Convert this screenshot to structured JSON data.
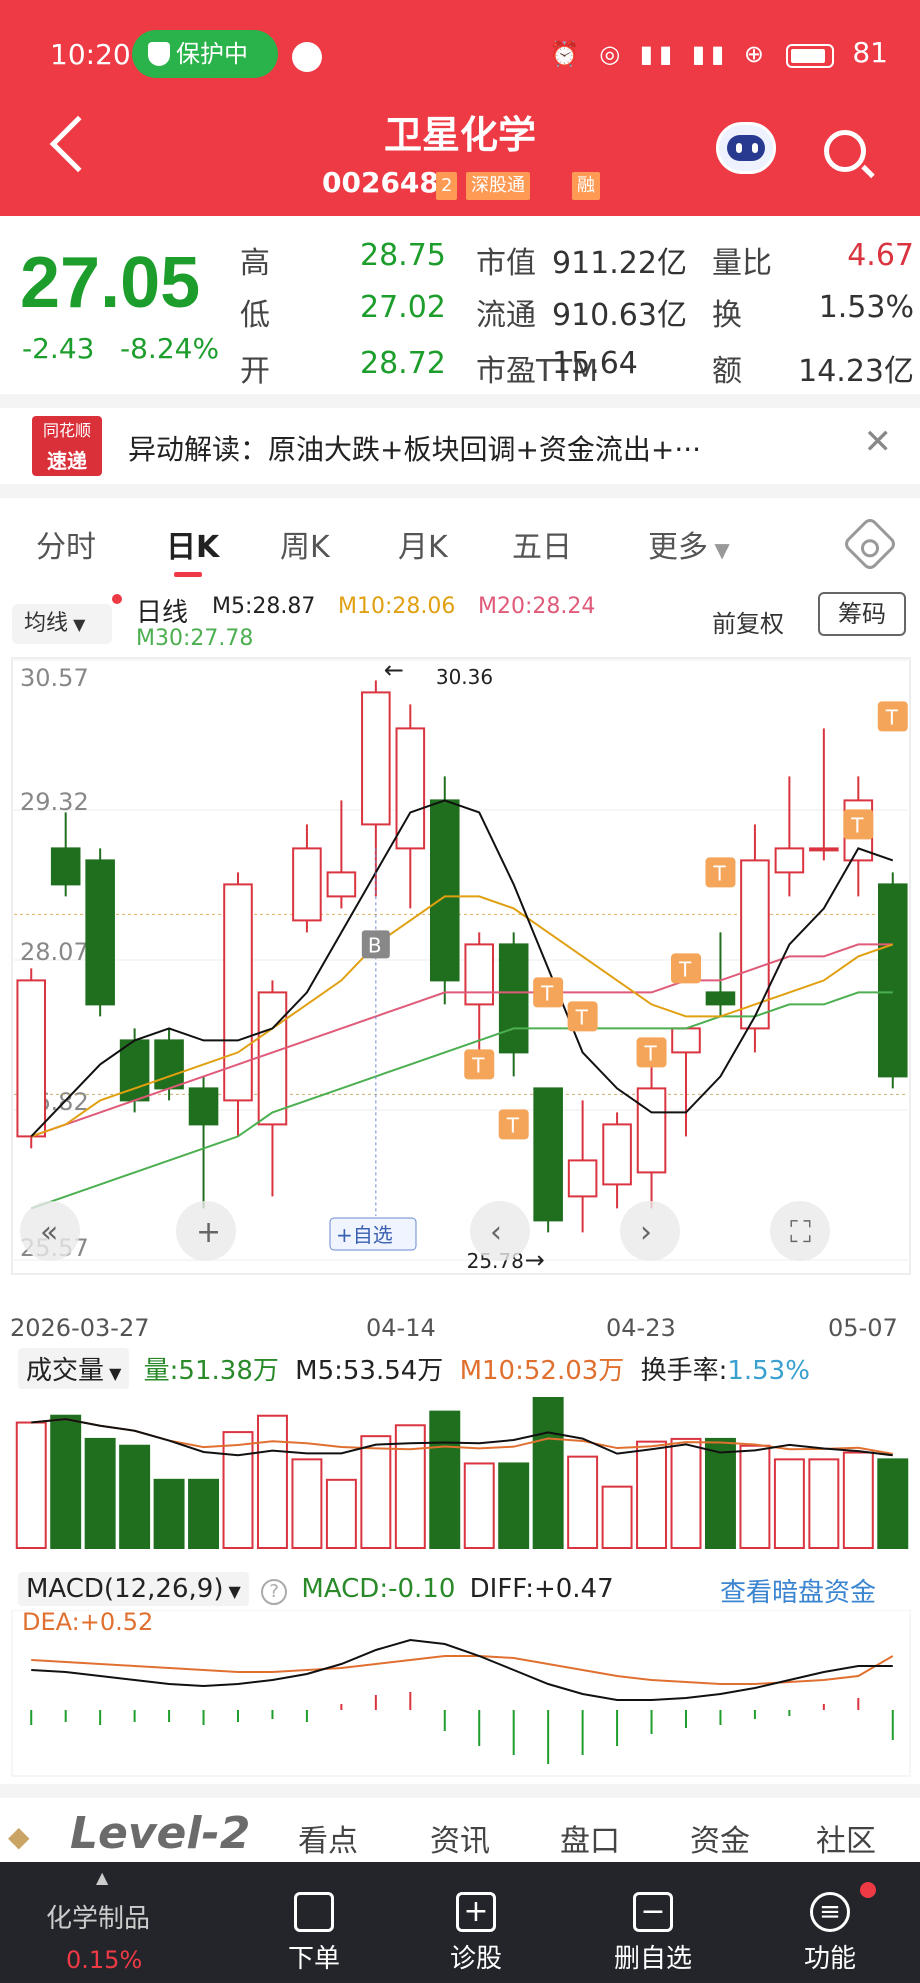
{
  "status": {
    "time": "10:20",
    "protect": "保护中",
    "battery": "81"
  },
  "header": {
    "title": "卫星化学",
    "code": "002648",
    "tag_2": "2",
    "tag_sgt": "深股通",
    "tag_rong": "融"
  },
  "quote": {
    "price": "27.05",
    "change": "-2.43",
    "change_pct": "-8.24%",
    "stats": [
      {
        "label": "高",
        "value": "28.75"
      },
      {
        "label": "市值",
        "value": "911.22亿"
      },
      {
        "label": "量比",
        "value": "4.67"
      },
      {
        "label": "低",
        "value": "27.02"
      },
      {
        "label": "流通",
        "value": "910.63亿"
      },
      {
        "label": "换",
        "value": "1.53%"
      },
      {
        "label": "开",
        "value": "28.72"
      },
      {
        "label": "市盈TTM",
        "value": "15.64"
      },
      {
        "label": "额",
        "value": "14.23亿"
      }
    ]
  },
  "news": {
    "logo_top": "同花顺",
    "logo_bottom": "速递",
    "text": "异动解读：原油大跌+板块回调+资金流出+···",
    "close": "✕"
  },
  "tabs": [
    "分时",
    "日K",
    "周K",
    "月K",
    "五日",
    "更多"
  ],
  "ma": {
    "selector": "均线",
    "period": "日线",
    "m5": "M5:28.87",
    "m10": "M10:28.06",
    "m20": "M20:28.24",
    "m30": "M30:27.78",
    "adjust": "前复权",
    "chip": "筹码"
  },
  "chart_data": {
    "type": "candlestick",
    "y_ticks": [
      "30.57",
      "29.32",
      "28.07",
      "26.82",
      "25.57"
    ],
    "x_ticks": [
      "2026-03-27",
      "04-14",
      "04-23",
      "05-07"
    ],
    "annotations": {
      "high": "30.36",
      "low": "25.78",
      "buy_marker": "B",
      "t_marker": "T"
    },
    "candles": [
      {
        "o": 26.6,
        "h": 28.0,
        "l": 26.5,
        "c": 27.9
      },
      {
        "o": 29.0,
        "h": 29.3,
        "l": 28.6,
        "c": 28.7
      },
      {
        "o": 28.9,
        "h": 29.0,
        "l": 27.6,
        "c": 27.7
      },
      {
        "o": 27.4,
        "h": 27.5,
        "l": 26.8,
        "c": 26.9
      },
      {
        "o": 27.4,
        "h": 27.5,
        "l": 26.9,
        "c": 27.0
      },
      {
        "o": 27.0,
        "h": 27.1,
        "l": 26.0,
        "c": 26.7
      },
      {
        "o": 26.9,
        "h": 28.8,
        "l": 26.6,
        "c": 28.7
      },
      {
        "o": 26.7,
        "h": 27.9,
        "l": 26.1,
        "c": 27.8
      },
      {
        "o": 28.4,
        "h": 29.2,
        "l": 28.3,
        "c": 29.0
      },
      {
        "o": 28.6,
        "h": 29.4,
        "l": 28.5,
        "c": 28.8
      },
      {
        "o": 29.2,
        "h": 30.4,
        "l": 28.6,
        "c": 30.3
      },
      {
        "o": 29.0,
        "h": 30.2,
        "l": 28.5,
        "c": 30.0
      },
      {
        "o": 29.4,
        "h": 29.6,
        "l": 27.7,
        "c": 27.9
      },
      {
        "o": 27.7,
        "h": 28.3,
        "l": 27.2,
        "c": 28.2
      },
      {
        "o": 28.2,
        "h": 28.3,
        "l": 27.1,
        "c": 27.3
      },
      {
        "o": 27.0,
        "h": 27.0,
        "l": 25.8,
        "c": 25.9
      },
      {
        "o": 26.1,
        "h": 26.9,
        "l": 25.8,
        "c": 26.4
      },
      {
        "o": 26.2,
        "h": 26.8,
        "l": 26.0,
        "c": 26.7
      },
      {
        "o": 26.3,
        "h": 27.2,
        "l": 26.0,
        "c": 27.0
      },
      {
        "o": 27.3,
        "h": 27.5,
        "l": 26.6,
        "c": 27.5
      },
      {
        "o": 27.8,
        "h": 28.3,
        "l": 27.6,
        "c": 27.7
      },
      {
        "o": 27.5,
        "h": 29.2,
        "l": 27.3,
        "c": 28.9
      },
      {
        "o": 28.8,
        "h": 29.6,
        "l": 28.6,
        "c": 29.0
      },
      {
        "o": 29.0,
        "h": 30.0,
        "l": 28.9,
        "c": 29.0
      },
      {
        "o": 28.9,
        "h": 29.6,
        "l": 28.6,
        "c": 29.4
      },
      {
        "o": 28.7,
        "h": 28.8,
        "l": 27.0,
        "c": 27.1
      }
    ],
    "ma5": [
      26.6,
      26.9,
      27.2,
      27.4,
      27.5,
      27.4,
      27.4,
      27.5,
      27.8,
      28.3,
      28.8,
      29.3,
      29.4,
      29.3,
      28.7,
      28.0,
      27.3,
      27.0,
      26.8,
      26.8,
      27.1,
      27.6,
      28.2,
      28.5,
      29.0,
      28.9
    ],
    "ma10": [
      26.6,
      26.7,
      26.9,
      27.0,
      27.1,
      27.2,
      27.3,
      27.5,
      27.7,
      27.9,
      28.2,
      28.4,
      28.6,
      28.6,
      28.5,
      28.3,
      28.1,
      27.9,
      27.7,
      27.6,
      27.6,
      27.7,
      27.8,
      27.9,
      28.1,
      28.2
    ],
    "ma20": [
      26.6,
      26.7,
      26.8,
      26.9,
      27.0,
      27.1,
      27.2,
      27.3,
      27.4,
      27.5,
      27.6,
      27.7,
      27.8,
      27.8,
      27.8,
      27.8,
      27.8,
      27.8,
      27.8,
      27.9,
      27.9,
      28.0,
      28.1,
      28.1,
      28.2,
      28.2
    ],
    "ma30": [
      26.0,
      26.1,
      26.2,
      26.3,
      26.4,
      26.5,
      26.6,
      26.8,
      26.9,
      27.0,
      27.1,
      27.2,
      27.3,
      27.4,
      27.5,
      27.5,
      27.5,
      27.5,
      27.5,
      27.5,
      27.6,
      27.6,
      27.7,
      27.7,
      27.8,
      27.8
    ],
    "volume": [
      92,
      97,
      80,
      75,
      50,
      50,
      85,
      97,
      65,
      50,
      82,
      90,
      100,
      62,
      62,
      110,
      67,
      45,
      78,
      80,
      80,
      75,
      65,
      65,
      70,
      65
    ],
    "macd_hist": [
      -0.05,
      -0.04,
      -0.05,
      -0.04,
      -0.04,
      -0.05,
      -0.04,
      -0.03,
      -0.04,
      0.02,
      0.05,
      0.06,
      -0.07,
      -0.12,
      -0.15,
      -0.18,
      -0.15,
      -0.12,
      -0.08,
      -0.06,
      -0.05,
      -0.03,
      -0.02,
      0.02,
      0.04,
      -0.1
    ]
  },
  "volume_panel": {
    "label": "成交量",
    "vol": "量:51.38万",
    "m5": "M5:53.54万",
    "m10": "M10:52.03万",
    "turnover_label": "换手率:",
    "turnover": "1.53%"
  },
  "macd_panel": {
    "label": "MACD(12,26,9)",
    "macd": "MACD:-0.10",
    "diff": "DIFF:+0.47",
    "dea": "DEA:+0.52",
    "link": "查看暗盘资金"
  },
  "chart_controls": {
    "add_watch": "+自选"
  },
  "level2": {
    "logo": "Level-2",
    "tabs": [
      "看点",
      "资讯",
      "盘口",
      "资金",
      "社区"
    ]
  },
  "bottom": {
    "sector": "化学制品",
    "sector_pct": "0.15%",
    "items": [
      "下单",
      "诊股",
      "删自选",
      "功能"
    ]
  }
}
